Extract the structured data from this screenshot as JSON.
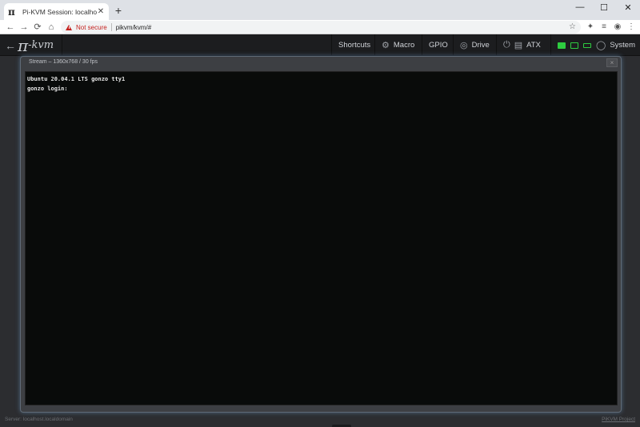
{
  "browser": {
    "tab": {
      "favicon": "π",
      "title": "Pi-KVM Session: localhost.localdomain",
      "close_label": "✕"
    },
    "new_tab_label": "+",
    "window_controls": {
      "minimize": "—",
      "maximize": "☐",
      "close": "✕"
    },
    "nav": {
      "back": "←",
      "forward": "→",
      "reload": "⟳",
      "home": "⌂"
    },
    "address": {
      "security_label": "Not secure",
      "url": "pikvm/kvm/#"
    },
    "icons": {
      "star": "☆",
      "extensions": "✦",
      "reading_list": "≡",
      "profile": "◉",
      "menu": "⋮"
    }
  },
  "kvm": {
    "logo": {
      "arrow": "←",
      "pi": "π",
      "text": "-kvm"
    },
    "menu": {
      "shortcuts": "Shortcuts",
      "macro": "Macro",
      "gpio": "GPIO",
      "drive": "Drive",
      "atx": "ATX",
      "system": "System"
    },
    "status_colors": {
      "led_on": "#2ecc40"
    },
    "stream": {
      "title": "Stream – 1360x768 / 30 fps",
      "close_label": "×",
      "console_lines": [
        "Ubuntu 20.04.1 LTS gonzo tty1",
        "gonzo login:"
      ]
    },
    "footer": {
      "server": "Server: localhost.localdomain",
      "project_link": "PiKVM Project"
    }
  }
}
